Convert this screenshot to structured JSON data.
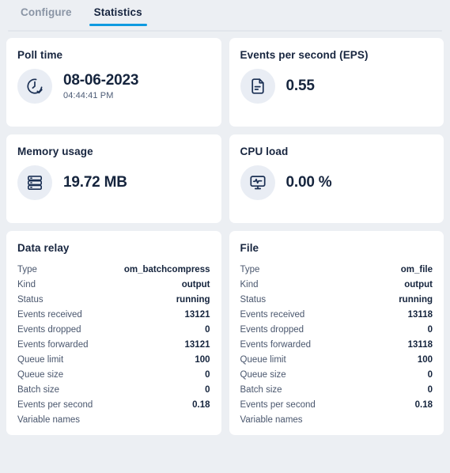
{
  "tabs": [
    {
      "label": "Configure",
      "active": false
    },
    {
      "label": "Statistics",
      "active": true
    }
  ],
  "colors": {
    "accent": "#0e9ae0",
    "background": "#eceff3",
    "card": "#ffffff",
    "icon_bubble": "#e9edf4",
    "text_dark": "#15243d",
    "text_muted": "#49566d",
    "tab_inactive": "#8a95a5"
  },
  "metrics": [
    {
      "title": "Poll time",
      "icon": "clock-check-icon",
      "value": "08-06-2023",
      "sub": "04:44:41 PM",
      "unit": ""
    },
    {
      "title": "Events per second (EPS)",
      "icon": "document-icon",
      "value": "0.55",
      "sub": "",
      "unit": ""
    },
    {
      "title": "Memory usage",
      "icon": "database-icon",
      "value": "19.72",
      "sub": "",
      "unit": " MB"
    },
    {
      "title": "CPU load",
      "icon": "monitor-pulse-icon",
      "value": "0.00",
      "sub": "",
      "unit": " %"
    }
  ],
  "details": [
    {
      "title": "Data relay",
      "rows": [
        {
          "label": "Type",
          "value": "om_batchcompress"
        },
        {
          "label": "Kind",
          "value": "output"
        },
        {
          "label": "Status",
          "value": "running"
        },
        {
          "label": "Events received",
          "value": "13121"
        },
        {
          "label": "Events dropped",
          "value": "0"
        },
        {
          "label": "Events forwarded",
          "value": "13121"
        },
        {
          "label": "Queue limit",
          "value": "100"
        },
        {
          "label": "Queue size",
          "value": "0"
        },
        {
          "label": "Batch size",
          "value": "0"
        },
        {
          "label": "Events per second",
          "value": "0.18"
        },
        {
          "label": "Variable names",
          "value": ""
        }
      ]
    },
    {
      "title": "File",
      "rows": [
        {
          "label": "Type",
          "value": "om_file"
        },
        {
          "label": "Kind",
          "value": "output"
        },
        {
          "label": "Status",
          "value": "running"
        },
        {
          "label": "Events received",
          "value": "13118"
        },
        {
          "label": "Events dropped",
          "value": "0"
        },
        {
          "label": "Events forwarded",
          "value": "13118"
        },
        {
          "label": "Queue limit",
          "value": "100"
        },
        {
          "label": "Queue size",
          "value": "0"
        },
        {
          "label": "Batch size",
          "value": "0"
        },
        {
          "label": "Events per second",
          "value": "0.18"
        },
        {
          "label": "Variable names",
          "value": ""
        }
      ]
    }
  ]
}
